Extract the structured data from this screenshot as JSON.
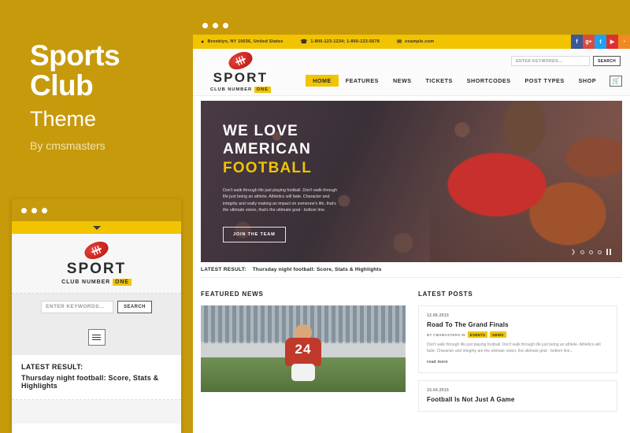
{
  "promo": {
    "title_line1": "Sports",
    "title_line2": "Club",
    "subtitle": "Theme",
    "byline": "By cmsmasters",
    "accent_color": "#c79a0b",
    "highlight_color": "#f2c400"
  },
  "brand": {
    "name": "SPORT",
    "tagline_prefix": "CLUB NUMBER",
    "tagline_highlight": "ONE",
    "ball_icon": "football-icon"
  },
  "topbar": {
    "address": "Brooklyn, NY 10036, United States",
    "address_icon": "location-pin-icon",
    "phones": "1-800-123-1234; 1-800-123-5678",
    "phone_icon": "phone-icon",
    "email": "example.com",
    "email_icon": "envelope-icon",
    "socials": [
      {
        "name": "facebook-icon",
        "glyph": "f",
        "color": "#3b5998"
      },
      {
        "name": "googleplus-icon",
        "glyph": "g+",
        "color": "#dd4b39"
      },
      {
        "name": "twitter-icon",
        "glyph": "t",
        "color": "#1da1f2"
      },
      {
        "name": "youtube-icon",
        "glyph": "▶",
        "color": "#e02f2f"
      },
      {
        "name": "rss-icon",
        "glyph": "◔",
        "color": "#f08a24"
      }
    ]
  },
  "search": {
    "placeholder": "ENTER KEYWORDS...",
    "button_label": "SEARCH"
  },
  "nav": {
    "items": [
      {
        "label": "HOME",
        "active": true
      },
      {
        "label": "FEATURES",
        "active": false
      },
      {
        "label": "NEWS",
        "active": false
      },
      {
        "label": "TICKETS",
        "active": false
      },
      {
        "label": "SHORTCODES",
        "active": false
      },
      {
        "label": "POST TYPES",
        "active": false
      },
      {
        "label": "SHOP",
        "active": false
      }
    ],
    "cart_icon": "shopping-cart-icon"
  },
  "hero": {
    "line1": "WE LOVE",
    "line2_white": "AMERICAN",
    "line2_yellow": "FOOTBALL",
    "paragraph": "Don't walk through life just playing football. Don't walk through life just being an athlete. Athletics will fade. Character and integrity and really making an impact on someone's life, that's the ultimate vision, that's the ultimate goal - bottom line.",
    "button_label": "JOIN THE TEAM",
    "slider_dots": 3,
    "pause_icon": "pause-icon",
    "next_icon": "chevron-right-icon"
  },
  "result_strip": {
    "label": "LATEST RESULT:",
    "text": "Thursday night football: Score, Stats & Highlights"
  },
  "sections": {
    "featured_news_title": "FEATURED NEWS",
    "latest_posts_title": "LATEST POSTS"
  },
  "featured_news": {
    "image_alt": "football-player-number-24-stadium"
  },
  "posts": [
    {
      "date": "12.06.2015",
      "title": "Road To The Grand Finals",
      "meta_by": "BY CMSMASTERS IN",
      "tags": [
        "EVENTS",
        "NEWS"
      ],
      "excerpt": "Don't walk through life just playing football. Don't walk through life just being an athlete. Athletics will fade. Character and integrity are the ultimate vision, the ultimate goal - bottom line...",
      "read_more": "read more"
    },
    {
      "date": "15.04.2015",
      "title": "Football Is Not Just A Game",
      "meta_by": "",
      "tags": [],
      "excerpt": "",
      "read_more": ""
    }
  ],
  "mobile": {
    "menu_icon": "hamburger-menu-icon",
    "caret_icon": "chevron-down-icon",
    "result_label": "LATEST RESULT:",
    "result_text": "Thursday night football: Score, Stats & Highlights"
  }
}
